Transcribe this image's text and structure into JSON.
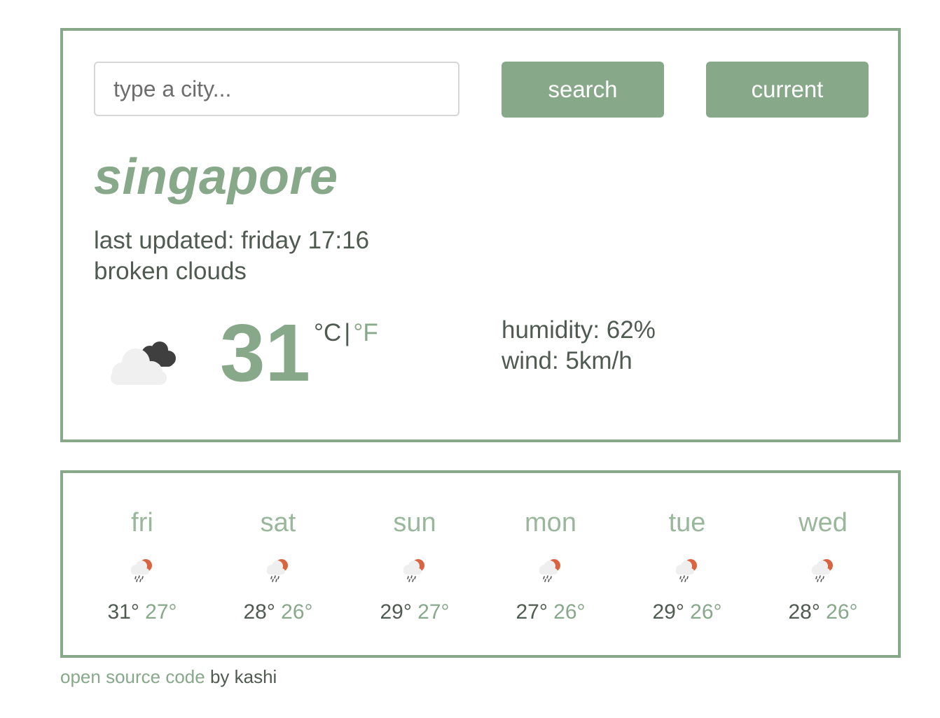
{
  "search": {
    "placeholder": "type a city...",
    "search_label": "search",
    "current_label": "current"
  },
  "city": "singapore",
  "last_updated": "last updated: friday 17:16",
  "description": "broken clouds",
  "current": {
    "icon": "broken-clouds-icon",
    "temperature": "31",
    "unit_c": "°C",
    "unit_sep": "|",
    "unit_f": "°F",
    "humidity": "humidity: 62%",
    "wind": "wind: 5km/h"
  },
  "forecast": [
    {
      "day": "fri",
      "max": "31°",
      "min": "27°",
      "icon": "rain-sun-icon"
    },
    {
      "day": "sat",
      "max": "28°",
      "min": "26°",
      "icon": "rain-sun-icon"
    },
    {
      "day": "sun",
      "max": "29°",
      "min": "27°",
      "icon": "rain-sun-icon"
    },
    {
      "day": "mon",
      "max": "27°",
      "min": "26°",
      "icon": "rain-sun-icon"
    },
    {
      "day": "tue",
      "max": "29°",
      "min": "26°",
      "icon": "rain-sun-icon"
    },
    {
      "day": "wed",
      "max": "28°",
      "min": "26°",
      "icon": "rain-sun-icon"
    }
  ],
  "footer": {
    "link_text": "open source code",
    "suffix": " by kashi"
  },
  "colors": {
    "accent": "#88a88a",
    "text": "#4f5b50",
    "sun": "#d9643f"
  }
}
